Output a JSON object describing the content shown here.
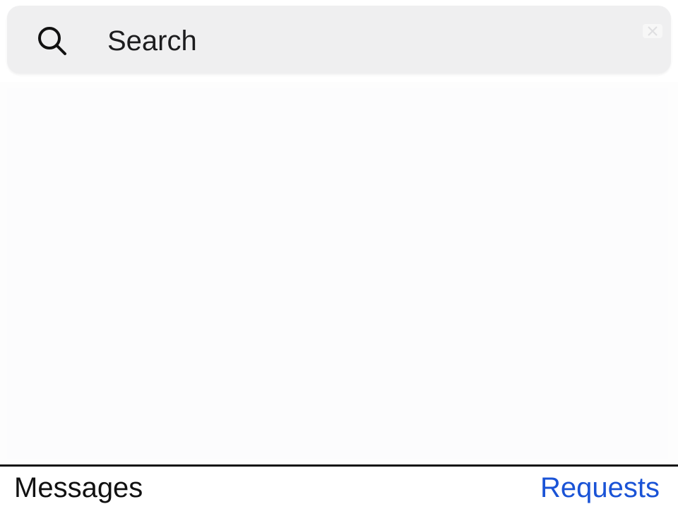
{
  "search": {
    "placeholder": "Search",
    "value": "",
    "icon": "search-icon",
    "clear_icon": "clear-icon"
  },
  "content": {
    "items": []
  },
  "tabs": {
    "messages_label": "Messages",
    "requests_label": "Requests",
    "active": "messages"
  },
  "colors": {
    "accent": "#1a53d6",
    "search_bg": "#efeff0",
    "text": "#111111",
    "divider": "#111111"
  }
}
